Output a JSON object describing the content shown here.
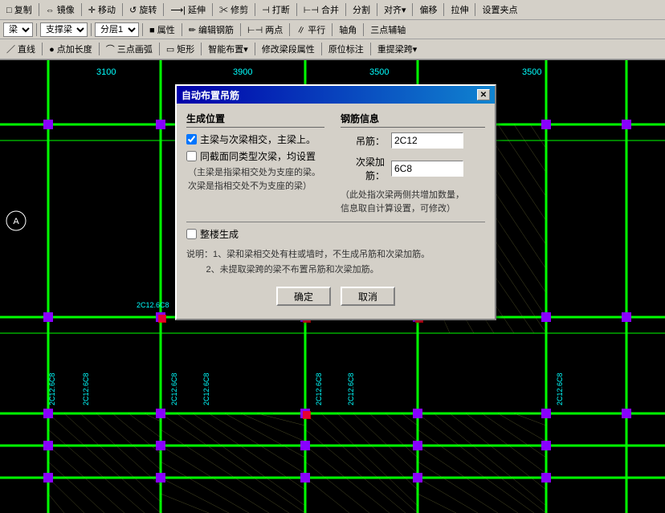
{
  "toolbar": {
    "row1": {
      "buttons": [
        "复制",
        "镜像",
        "移动",
        "旋转",
        "延伸",
        "修剪",
        "打断",
        "合并",
        "分割",
        "对齐",
        "偏移",
        "拉伸",
        "设置夹点"
      ]
    },
    "row2": {
      "selects": [
        "梁",
        "支撑梁",
        "分层1"
      ],
      "buttons": [
        "属性",
        "编辑钢筋",
        "两点",
        "平行",
        "轴角",
        "三点辅轴"
      ]
    },
    "row3": {
      "buttons": [
        "直线",
        "点加长度",
        "三点画弧",
        "矩形",
        "智能布置",
        "修改梁段属性",
        "原位标注",
        "重提梁跨"
      ]
    }
  },
  "dialog": {
    "title": "自动布置吊筋",
    "sections": {
      "generation": "生成位置",
      "rebar_info": "钢筋信息"
    },
    "checkboxes": {
      "primary_secondary": {
        "label": "主梁与次梁相交，主梁上。",
        "checked": true
      },
      "same_type": {
        "label": "同截面同类型次梁，均设置",
        "checked": false
      }
    },
    "notes": {
      "beam_note": "（主梁是指梁相交处为支座的梁。\n次梁是指相交处不为支座的梁）",
      "whole_floor_label": "整楼生成",
      "info_note": "说明：1、梁和梁相交处有柱或墙时，不生成吊筋和次梁加筋。\n        2、未提取梁跨的梁不布置吊筋和次梁加筋。"
    },
    "rebar": {
      "hanging_label": "吊筋：",
      "hanging_value": "2C12",
      "secondary_label": "次梁加筋：",
      "secondary_value": "6C8",
      "secondary_note": "（此处指次梁两侧共增加数量，\n信息取自计算设置，可修改）"
    },
    "buttons": {
      "confirm": "确定",
      "cancel": "取消"
    }
  }
}
